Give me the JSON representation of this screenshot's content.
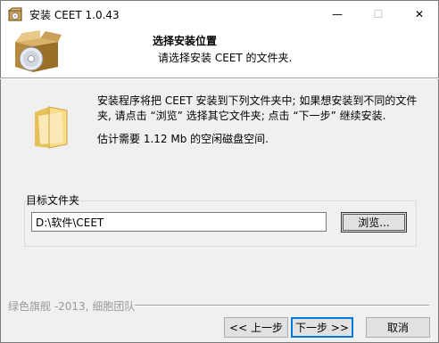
{
  "window": {
    "title": "安装 CEET 1.0.43"
  },
  "header": {
    "title": "选择安装位置",
    "subtitle": "请选择安装 CEET 的文件夹."
  },
  "content": {
    "description": "安装程序将把 CEET 安装到下列文件夹中; 如果想安装到不同的文件夹, 请点击 “浏览” 选择其它文件夹; 点击 “下一步” 继续安装.",
    "space_required": "估计需要 1.12 Mb 的空闲磁盘空间."
  },
  "destination": {
    "label": "目标文件夹",
    "path": "D:\\软件\\CEET",
    "browse_label": "浏览..."
  },
  "footer": {
    "brand": "绿色旗舰 -2013, 细胞团队",
    "back_label": "<< 上一步",
    "next_label": "下一步 >>",
    "cancel_label": "取消"
  },
  "icons": {
    "app": "installer-app-icon",
    "header": "box-disc-icon",
    "folder": "folder-icon"
  }
}
